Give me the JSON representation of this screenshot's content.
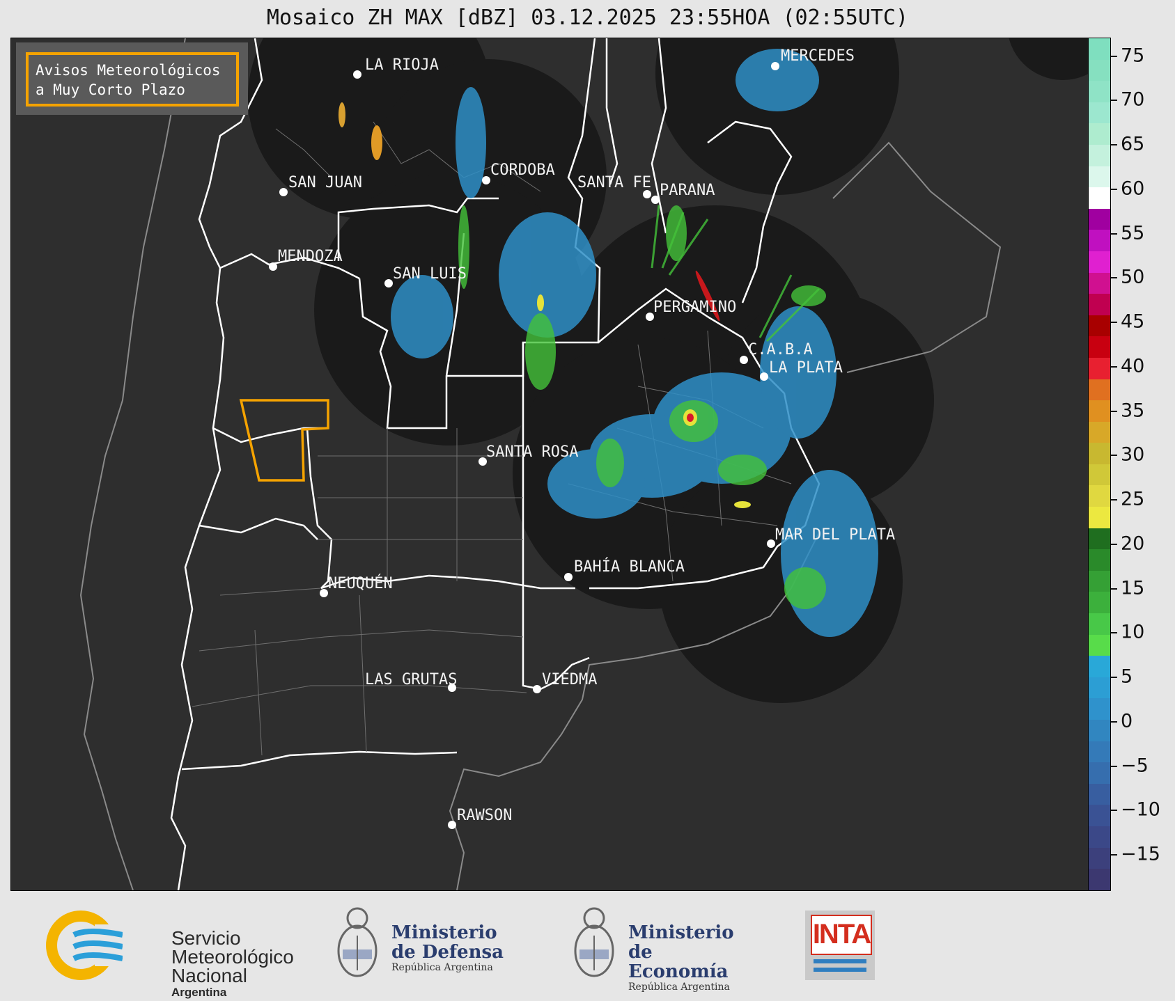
{
  "title": "Mosaico ZH MAX [dBZ] 03.12.2025 23:55HOA (02:55UTC)",
  "legend": {
    "line1": "Avisos Meteorológicos",
    "line2": "a Muy Corto Plazo",
    "border_color": "#f5a300"
  },
  "cities": [
    {
      "name": "LA RIOJA",
      "label": "LA RIOJA"
    },
    {
      "name": "SAN JUAN",
      "label": "SAN JUAN"
    },
    {
      "name": "CORDOBA",
      "label": "CORDOBA"
    },
    {
      "name": "SANTA FE",
      "label": "SANTA FE"
    },
    {
      "name": "PARANA",
      "label": "PARANA"
    },
    {
      "name": "MENDOZA",
      "label": "MENDOZA"
    },
    {
      "name": "SAN LUIS",
      "label": "SAN LUIS"
    },
    {
      "name": "PERGAMINO",
      "label": "PERGAMINO"
    },
    {
      "name": "CABA",
      "label": "C.A.B.A"
    },
    {
      "name": "LA PLATA",
      "label": "LA PLATA"
    },
    {
      "name": "SANTA ROSA",
      "label": "SANTA ROSA"
    },
    {
      "name": "MAR DEL PLATA",
      "label": "MAR DEL PLATA"
    },
    {
      "name": "BAHIA BLANCA",
      "label": "BAHÍA BLANCA"
    },
    {
      "name": "NEUQUEN",
      "label": "NEUQUÉN"
    },
    {
      "name": "LAS GRUTAS",
      "label": "LAS GRUTAS"
    },
    {
      "name": "VIEDMA",
      "label": "VIEDMA"
    },
    {
      "name": "RAWSON",
      "label": "RAWSON"
    },
    {
      "name": "MERCEDES",
      "label": "MERCEDES"
    }
  ],
  "colorbar": {
    "unit": "dBZ",
    "ticks": [
      "75",
      "70",
      "65",
      "60",
      "55",
      "50",
      "45",
      "40",
      "35",
      "30",
      "25",
      "20",
      "15",
      "10",
      "5",
      "0",
      "−5",
      "−10",
      "−15"
    ],
    "range": [
      -19,
      77
    ]
  },
  "logos": {
    "smn": {
      "line1": "Servicio",
      "line2": "Meteorológico",
      "line3": "Nacional",
      "line4": "Argentina"
    },
    "defensa": {
      "title1": "Ministerio",
      "title2": "de Defensa",
      "sub": "República Argentina"
    },
    "economia": {
      "title1": "Ministerio",
      "title2": "de Economía",
      "sub": "República Argentina"
    },
    "inta": {
      "text": "INTA"
    }
  }
}
